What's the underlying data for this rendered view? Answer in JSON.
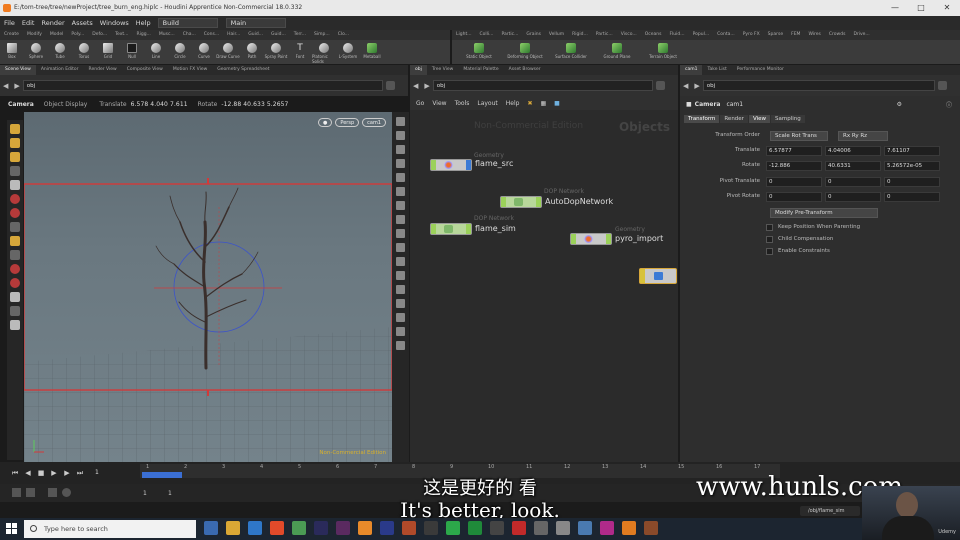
{
  "window": {
    "title": "E:/tom-tree/tree/newProject/tree_burn_eng.hiplc - Houdini Apprentice Non-Commercial 18.0.332"
  },
  "menu": {
    "items": [
      "File",
      "Edit",
      "Render",
      "Assets",
      "Windows",
      "Help"
    ],
    "desktop": "Build",
    "context": "Main"
  },
  "shelf": {
    "left_tabs": [
      "Create",
      "Modify",
      "Model",
      "Poly...",
      "Defo...",
      "Text...",
      "Rigg...",
      "Musc...",
      "Cha...",
      "Cons...",
      "Hair...",
      "Guid...",
      "Guid...",
      "Terr...",
      "Simp...",
      "Clo..."
    ],
    "right_tabs": [
      "Light...",
      "Colli...",
      "Partic...",
      "Grains",
      "Vellum",
      "Rigid...",
      "Partic...",
      "Visco...",
      "Oceans",
      "Fluid...",
      "Popul...",
      "Conta...",
      "Pyro FX",
      "Sparse",
      "FEM",
      "Wires",
      "Crowds",
      "Drive..."
    ],
    "left_tools": [
      "Box",
      "Sphere",
      "Tube",
      "Torus",
      "Grid",
      "Null",
      "Line",
      "Circle",
      "Curve",
      "Draw Curve",
      "Path",
      "Spray Paint",
      "Font",
      "Platonic Solids",
      "L-System",
      "Metaball"
    ],
    "right_tools": [
      "Static Object",
      "Deforming Object",
      "Surface Collider",
      "Ground Plane",
      "Terrain Object"
    ]
  },
  "panes": {
    "left_tabs": [
      "Scene View",
      "Animation Editor",
      "Render View",
      "Composite View",
      "Motion FX View",
      "Geometry Spreadsheet"
    ],
    "mid_tabs": [
      "obj",
      "Tree View",
      "Material Palette",
      "Asset Browser"
    ],
    "right_tabs": [
      "cam1",
      "Take List",
      "Performance Monitor"
    ]
  },
  "paths": {
    "left": "obj",
    "mid": "obj",
    "right": "obj"
  },
  "viewport": {
    "camera_label": "Camera",
    "object_display": "Object Display",
    "translate_label": "Translate",
    "translate_values": "6.578  4.040  7.611",
    "rotate_label": "Rotate",
    "rotate_values": "-12.88  40.633  5.2657",
    "persp_button": "Persp",
    "cam_button": "cam1",
    "watermark": "Non-Commercial Edition"
  },
  "network": {
    "menu": [
      "Go",
      "View",
      "Tools",
      "Layout",
      "Help"
    ],
    "watermark": "Non-Commercial Edition",
    "context_label": "Objects",
    "nodes": [
      {
        "type": "Geometry",
        "name": "flame_src"
      },
      {
        "type": "DOP Network",
        "name": "AutoDopNetwork"
      },
      {
        "type": "DOP Network",
        "name": "flame_sim"
      },
      {
        "type": "Geometry",
        "name": "pyro_import"
      }
    ]
  },
  "params": {
    "node_type": "Camera",
    "node_name": "cam1",
    "tabs": [
      "Transform",
      "Render",
      "View",
      "Sampling"
    ],
    "transform_order_label": "Transform Order",
    "transform_order_value": "Scale Rot Trans",
    "rotate_order_value": "Rx Ry Rz",
    "rows": [
      {
        "label": "Translate",
        "values": [
          "6.57877",
          "4.04006",
          "7.61107"
        ]
      },
      {
        "label": "Rotate",
        "values": [
          "-12.886",
          "40.6331",
          "5.26572e-05"
        ]
      },
      {
        "label": "Pivot Translate",
        "values": [
          "0",
          "0",
          "0"
        ]
      },
      {
        "label": "Pivot Rotate",
        "values": [
          "0",
          "0",
          "0"
        ]
      }
    ],
    "modify_button": "Modify Pre-Transform",
    "checkboxes": [
      "Keep Position When Parenting",
      "Child Compensation",
      "Enable Constraints"
    ]
  },
  "timeline": {
    "frame": "1",
    "ticks": [
      "1",
      "2",
      "3",
      "4",
      "5",
      "6",
      "7",
      "8",
      "9",
      "10",
      "11",
      "12",
      "13",
      "14",
      "15",
      "16",
      "17"
    ],
    "start": "1",
    "end": "1"
  },
  "subtitles": {
    "zh": "这是更好的 看",
    "en": "It's better, look."
  },
  "watermark": "www.hunls.com",
  "taskbar": {
    "search_placeholder": "Type here to search",
    "tray_label": "/obj/flame_sim",
    "webcam_label": "Udemy"
  }
}
